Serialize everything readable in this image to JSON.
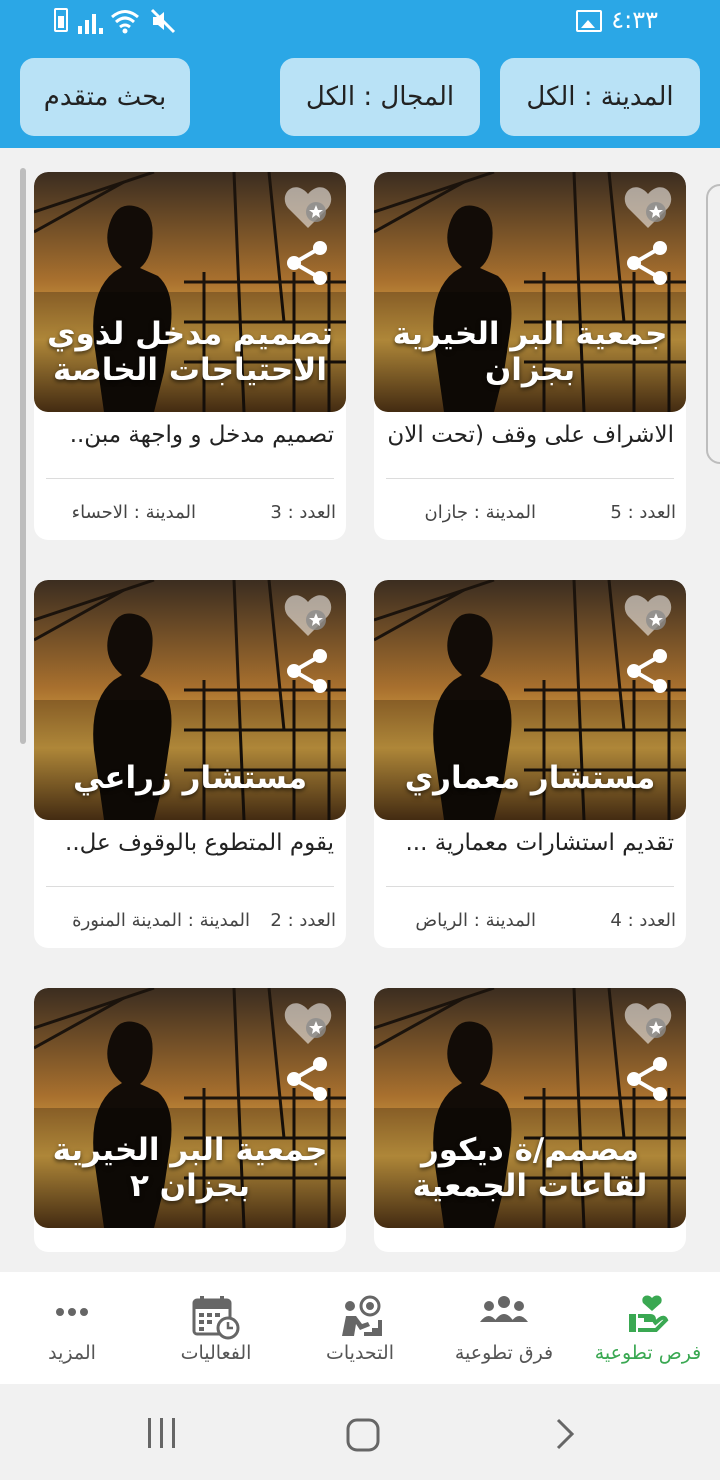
{
  "status_bar": {
    "time": "٤:٣٣"
  },
  "filters": {
    "city": "المدينة : الكل",
    "field": "المجال : الكل",
    "advanced": "بحث متقدم"
  },
  "count_label": "العدد :",
  "city_label": "المدينة :",
  "cards": [
    {
      "title": "جمعية البر الخيرية بجزان",
      "description": "الاشراف على وقف (تحت الان..",
      "count": "5",
      "city": "جازان"
    },
    {
      "title": "تصميم مدخل لذوي الاحتياجات الخاصة",
      "description": "تصميم مدخل و واجهة مبن..",
      "count": "3",
      "city": "الاحساء"
    },
    {
      "title": "مستشار معماري",
      "description": "تقديم استشارات معمارية ...",
      "count": "4",
      "city": "الرياض"
    },
    {
      "title": "مستشار زراعي",
      "description": "يقوم المتطوع بالوقوف عل..",
      "count": "2",
      "city": "المدينة المنورة"
    },
    {
      "title": "مصمم/ة ديكور لقاعات الجمعية",
      "description": "",
      "count": "",
      "city": ""
    },
    {
      "title": "جمعية البر الخيرية بجزان ٢",
      "description": "",
      "count": "",
      "city": ""
    }
  ],
  "bottom_nav": [
    {
      "label": "فرص تطوعية",
      "icon": "volunteer-hand-heart-icon",
      "active": true
    },
    {
      "label": "فرق تطوعية",
      "icon": "teams-icon",
      "active": false
    },
    {
      "label": "التحديات",
      "icon": "challenges-icon",
      "active": false
    },
    {
      "label": "الفعاليات",
      "icon": "calendar-events-icon",
      "active": false
    },
    {
      "label": "المزيد",
      "icon": "more-icon",
      "active": false
    }
  ],
  "colors": {
    "header": "#2ba7e6",
    "filter_chip": "#b9e2f6",
    "active_tab": "#3aa852"
  }
}
